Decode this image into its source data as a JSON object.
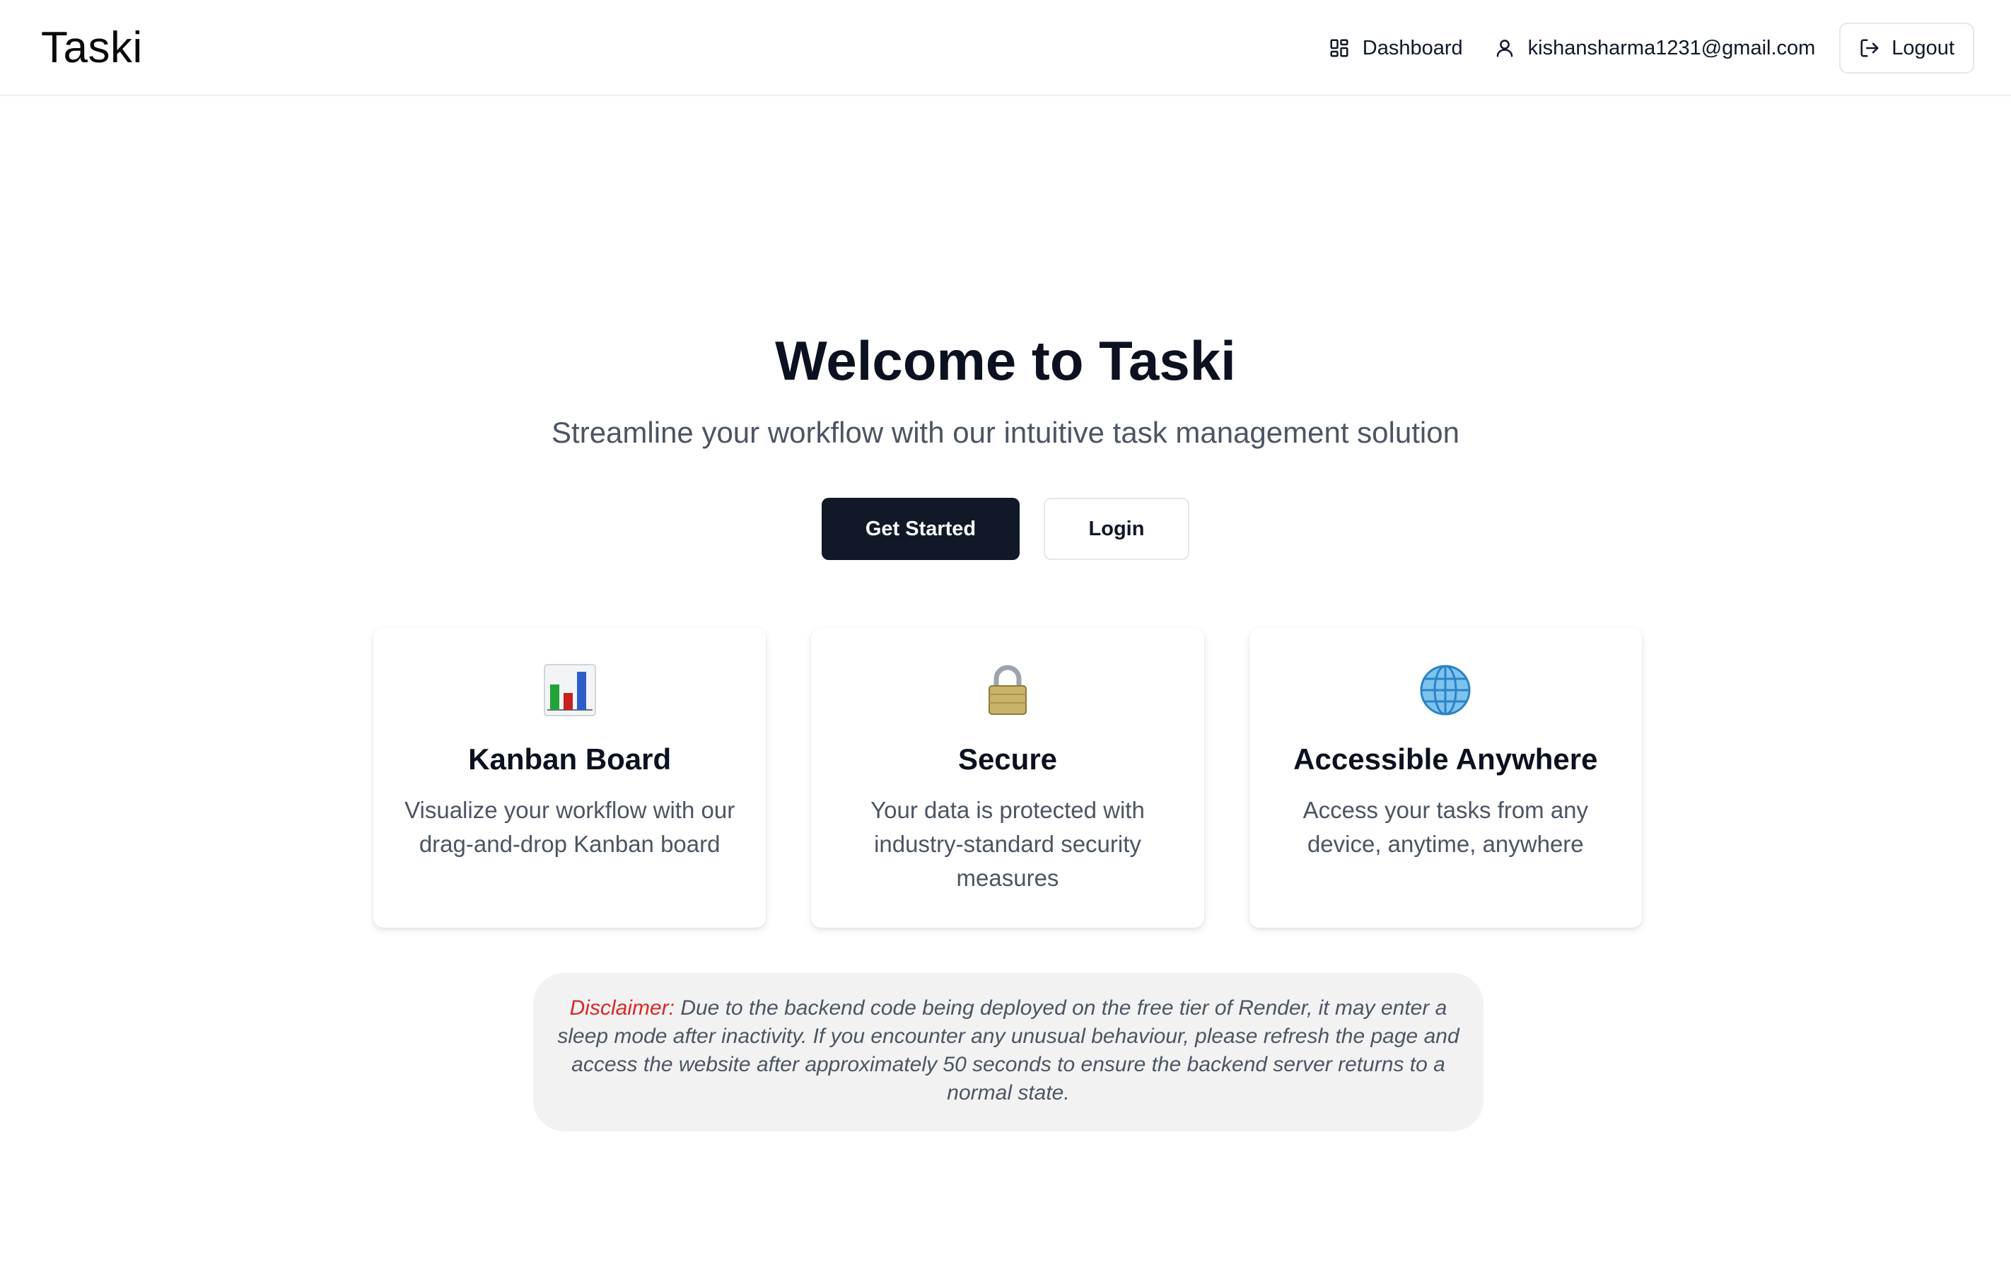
{
  "header": {
    "brand": "Taski",
    "nav": {
      "dashboard_label": "Dashboard",
      "user_email": "kishansharma1231@gmail.com",
      "logout_label": "Logout"
    }
  },
  "hero": {
    "title": "Welcome to Taski",
    "subtitle": "Streamline your workflow with our intuitive task management solution",
    "primary_button": "Get Started",
    "secondary_button": "Login"
  },
  "features": [
    {
      "icon": "bar-chart-icon",
      "title": "Kanban Board",
      "description": "Visualize your workflow with our drag-and-drop Kanban board"
    },
    {
      "icon": "lock-icon",
      "title": "Secure",
      "description": "Your data is protected with industry-standard security measures"
    },
    {
      "icon": "globe-icon",
      "title": "Accessible Anywhere",
      "description": "Access your tasks from any device, anytime, anywhere"
    }
  ],
  "disclaimer": {
    "label": "Disclaimer:",
    "text": "Due to the backend code being deployed on the free tier of Render, it may enter a sleep mode after inactivity. If you encounter any unusual behaviour, please refresh the page and access the website after approximately 50 seconds to ensure the backend server returns to a normal state."
  },
  "colors": {
    "primary_button_bg": "#111827",
    "disclaimer_label": "#dc2626",
    "disclaimer_bg": "#f2f2f2"
  }
}
